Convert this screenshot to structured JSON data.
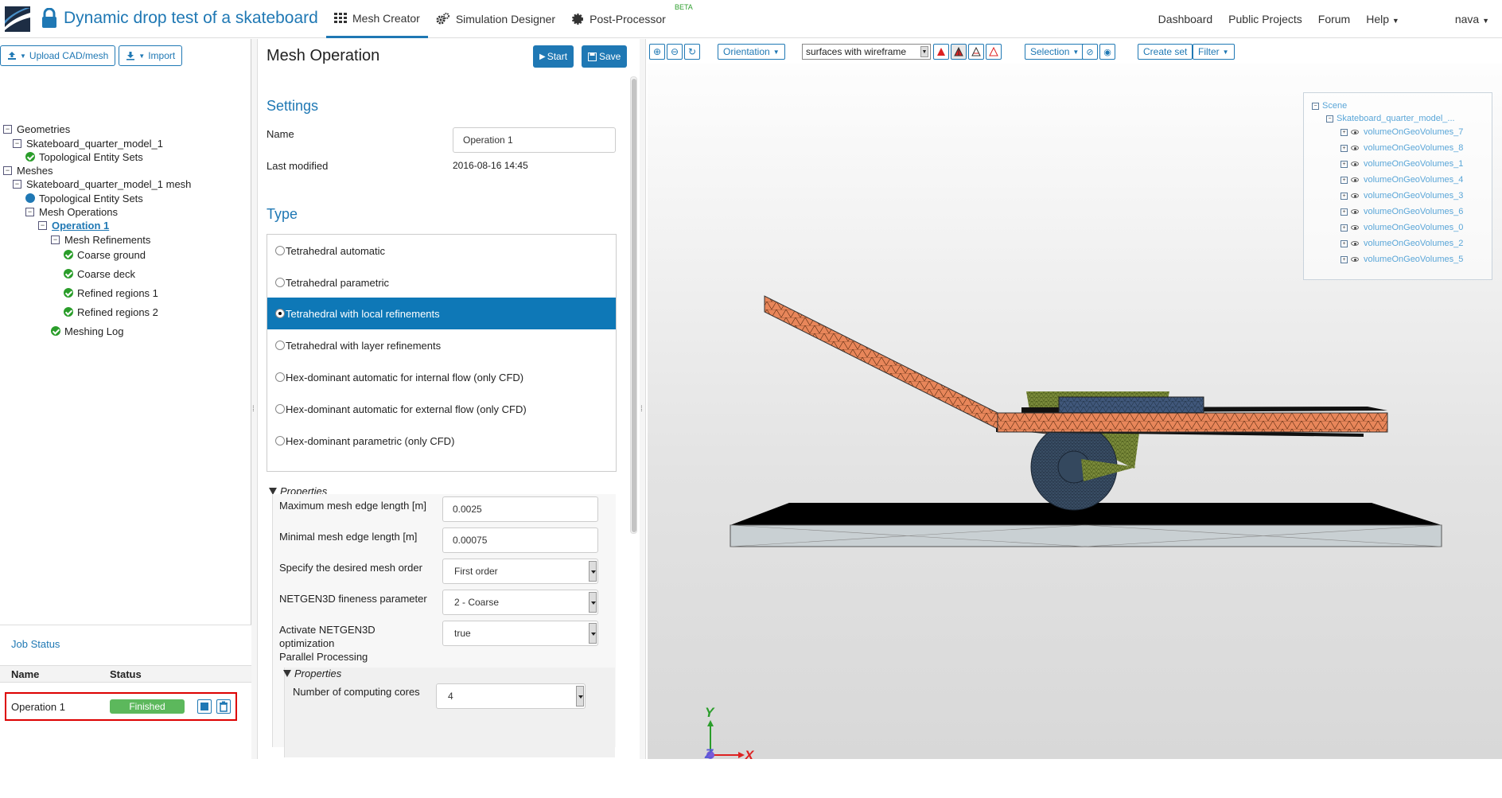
{
  "header": {
    "title": "Dynamic drop test of a skateboard",
    "tabs": [
      {
        "label": "Mesh Creator",
        "icon": "grid-icon"
      },
      {
        "label": "Simulation Designer",
        "icon": "gears-icon"
      },
      {
        "label": "Post-Processor",
        "icon": "cog-icon",
        "badge": "BETA"
      }
    ],
    "nav": [
      "Dashboard",
      "Public Projects",
      "Forum",
      "Help"
    ],
    "user": "nava"
  },
  "left": {
    "upload_label": "Upload CAD/mesh",
    "import_label": "Import",
    "tree": {
      "geometries": "Geometries",
      "geo_model": "Skateboard_quarter_model_1",
      "geo_tes": "Topological Entity Sets",
      "meshes": "Meshes",
      "mesh_model": "Skateboard_quarter_model_1 mesh",
      "mesh_tes": "Topological Entity Sets",
      "mesh_ops": "Mesh Operations",
      "operation": "Operation 1",
      "refinements": "Mesh Refinements",
      "ref1": "Coarse ground",
      "ref2": "Coarse deck",
      "ref3": "Refined regions 1",
      "ref4": "Refined regions 2",
      "log": "Meshing Log"
    },
    "job": {
      "title": "Job Status",
      "col_name": "Name",
      "col_status": "Status",
      "name": "Operation 1",
      "status": "Finished"
    }
  },
  "mid": {
    "title": "Mesh Operation",
    "start_label": "Start",
    "save_label": "Save",
    "settings_title": "Settings",
    "name_label": "Name",
    "name_value": "Operation 1",
    "modified_label": "Last modified",
    "modified_value": "2016-08-16 14:45",
    "type_title": "Type",
    "types": [
      "Tetrahedral automatic",
      "Tetrahedral parametric",
      "Tetrahedral with local refinements",
      "Tetrahedral with layer refinements",
      "Hex-dominant automatic for internal flow (only CFD)",
      "Hex-dominant automatic for external flow (only CFD)",
      "Hex-dominant parametric (only CFD)"
    ],
    "properties_label": "Properties",
    "props": {
      "max_label": "Maximum mesh edge length [m]",
      "max_value": "0.0025",
      "min_label": "Minimal mesh edge length [m]",
      "min_value": "0.00075",
      "order_label": "Specify the desired mesh order",
      "order_value": "First order",
      "fineness_label": "NETGEN3D fineness parameter",
      "fineness_value": "2 - Coarse",
      "optim_label": "Activate NETGEN3D optimization",
      "optim_value": "true",
      "parallel_label": "Parallel Processing",
      "inner_properties_label": "Properties",
      "cores_label": "Number of computing cores",
      "cores_value": "4"
    }
  },
  "viewer": {
    "orientation_label": "Orientation",
    "render_mode": "surfaces with wireframe",
    "selection_label": "Selection",
    "create_set_label": "Create set",
    "filter_label": "Filter",
    "scene": {
      "root": "Scene",
      "model": "Skateboard_quarter_model_...",
      "volumes": [
        "volumeOnGeoVolumes_7",
        "volumeOnGeoVolumes_8",
        "volumeOnGeoVolumes_1",
        "volumeOnGeoVolumes_4",
        "volumeOnGeoVolumes_3",
        "volumeOnGeoVolumes_6",
        "volumeOnGeoVolumes_0",
        "volumeOnGeoVolumes_2",
        "volumeOnGeoVolumes_5"
      ]
    },
    "axes": {
      "y": "Y",
      "z": "Z",
      "x": "X"
    }
  },
  "colors": {
    "accent": "#1f78b4",
    "selected": "#0e78b7",
    "finished": "#5cb85c",
    "deck": "#e8865a",
    "truck": "#7a8a3a",
    "wheel": "#2a3b4c",
    "highlight_border": "#dd0000"
  }
}
